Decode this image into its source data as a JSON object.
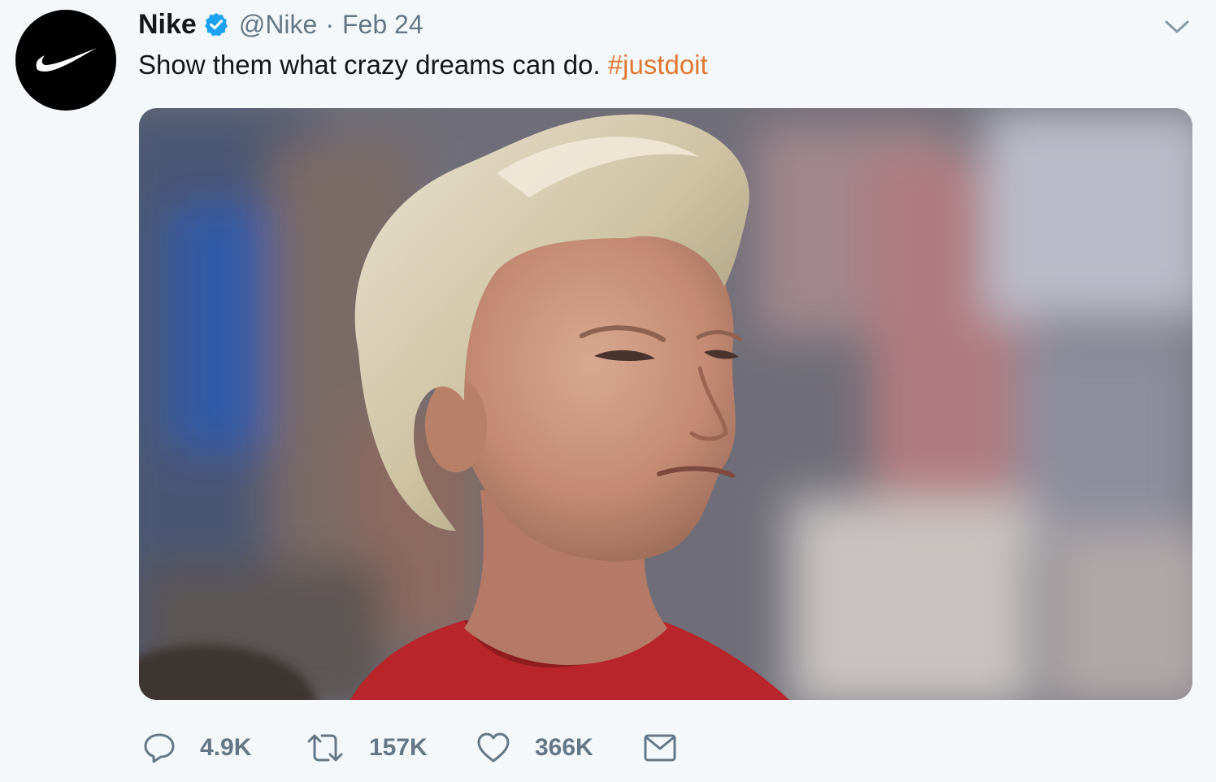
{
  "tweet": {
    "display_name": "Nike",
    "handle": "@Nike",
    "separator": "·",
    "timestamp": "Feb 24",
    "text": "Show them what crazy dreams can do. ",
    "hashtag": "#justdoit",
    "actions": {
      "replies": "4.9K",
      "retweets": "157K",
      "likes": "366K"
    }
  },
  "colors": {
    "background": "#f5f8fa",
    "hashtag": "#e0782f",
    "verified": "#1da1f2",
    "secondary_text": "#657786"
  },
  "icons": {
    "avatar": "nike-swoosh-icon",
    "verified": "verified-badge-icon",
    "menu": "chevron-down-icon",
    "reply": "reply-icon",
    "retweet": "retweet-icon",
    "like": "heart-icon",
    "message": "envelope-icon"
  }
}
